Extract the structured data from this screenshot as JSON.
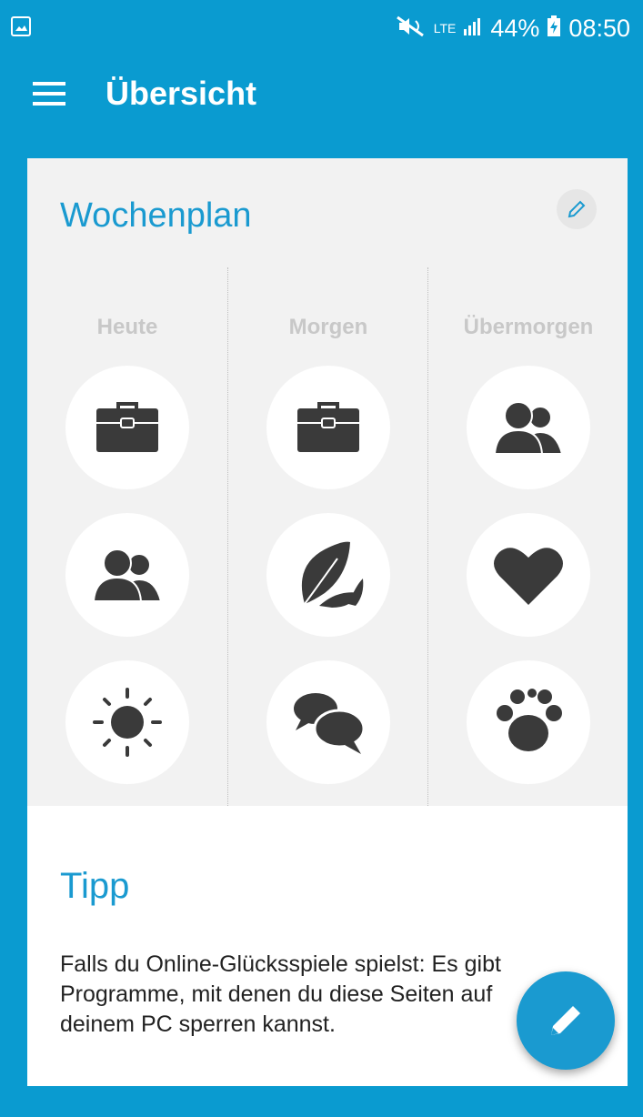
{
  "statusbar": {
    "network": "LTE",
    "battery": "44%",
    "time": "08:50"
  },
  "appbar": {
    "title": "Übersicht"
  },
  "weekplan": {
    "title": "Wochenplan",
    "days": [
      {
        "label": "Heute",
        "activities": [
          "briefcase-icon",
          "people-icon",
          "sun-icon"
        ]
      },
      {
        "label": "Morgen",
        "activities": [
          "briefcase-icon",
          "leaf-icon",
          "chat-icon"
        ]
      },
      {
        "label": "Übermorgen",
        "activities": [
          "people-icon",
          "heart-icon",
          "paw-icon"
        ]
      }
    ]
  },
  "tip": {
    "title": "Tipp",
    "text": "Falls du Online-Glücksspiele spielst: Es gibt Programme, mit denen du diese Seiten auf deinem PC sperren kannst."
  },
  "colors": {
    "primary": "#0a9bd0",
    "accent": "#1a9ad0",
    "icon": "#3a3a3a"
  }
}
